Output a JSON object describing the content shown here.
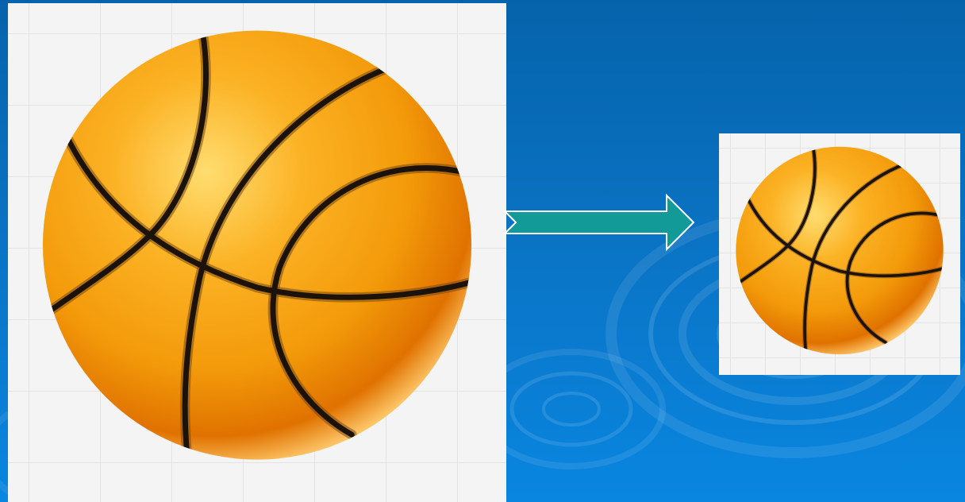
{
  "colors": {
    "background_top": "#0563ab",
    "background_bottom": "#0986e0",
    "panel": "#f4f4f4",
    "ball_highlight": "#ffdd70",
    "ball_mid": "#fba614",
    "ball_shadow": "#e07200",
    "seam": "#1b120a",
    "arrow_fill": "#119a97",
    "arrow_outline": "#ffffff"
  },
  "images": {
    "original": "basketball-icon",
    "scaled": "basketball-icon",
    "transition": "right-arrow-icon"
  }
}
